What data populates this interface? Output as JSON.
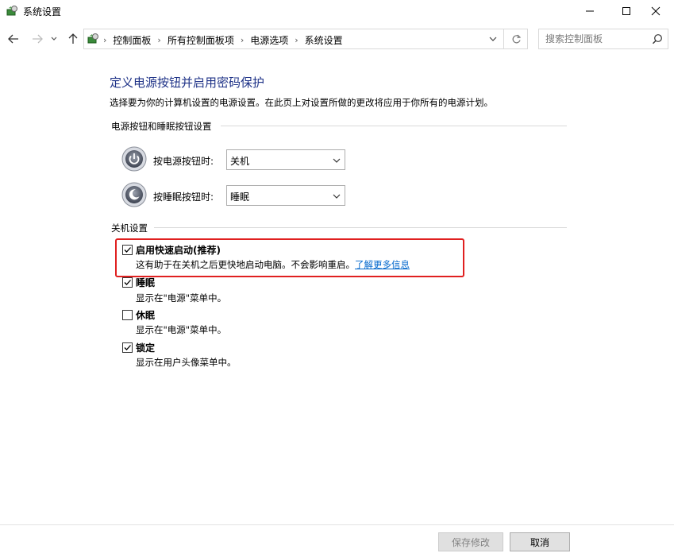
{
  "window": {
    "title": "系统设置",
    "icon": "power-options-icon",
    "controls": [
      "minimize-icon",
      "maximize-icon",
      "close-icon"
    ]
  },
  "address": {
    "breadcrumbs": [
      "控制面板",
      "所有控制面板项",
      "电源选项",
      "系统设置"
    ],
    "search_placeholder": "搜索控制面板"
  },
  "main": {
    "title": "定义电源按钮并启用密码保护",
    "description": "选择要为你的计算机设置的电源设置。在此页上对设置所做的更改将应用于你所有的电源计划。",
    "power_group": {
      "header": "电源按钮和睡眠按钮设置",
      "rows": [
        {
          "label": "按电源按钮时:",
          "value": "关机",
          "icon": "power-button-icon"
        },
        {
          "label": "按睡眠按钮时:",
          "value": "睡眠",
          "icon": "sleep-button-icon"
        }
      ]
    },
    "shutdown_group": {
      "header": "关机设置",
      "options": [
        {
          "label": "启用快速启动(推荐)",
          "checked": true,
          "desc": "这有助于在关机之后更快地启动电脑。不会影响重启。",
          "link": "了解更多信息",
          "highlighted": true
        },
        {
          "label": "睡眠",
          "checked": true,
          "desc": "显示在\"电源\"菜单中。"
        },
        {
          "label": "休眠",
          "checked": false,
          "desc": "显示在\"电源\"菜单中。"
        },
        {
          "label": "锁定",
          "checked": true,
          "desc": "显示在用户头像菜单中。"
        }
      ]
    }
  },
  "footer": {
    "save_label": "保存修改",
    "cancel_label": "取消",
    "save_enabled": false
  },
  "colors": {
    "title": "#1e3287",
    "link": "#0066cc",
    "highlight": "#e02020"
  }
}
